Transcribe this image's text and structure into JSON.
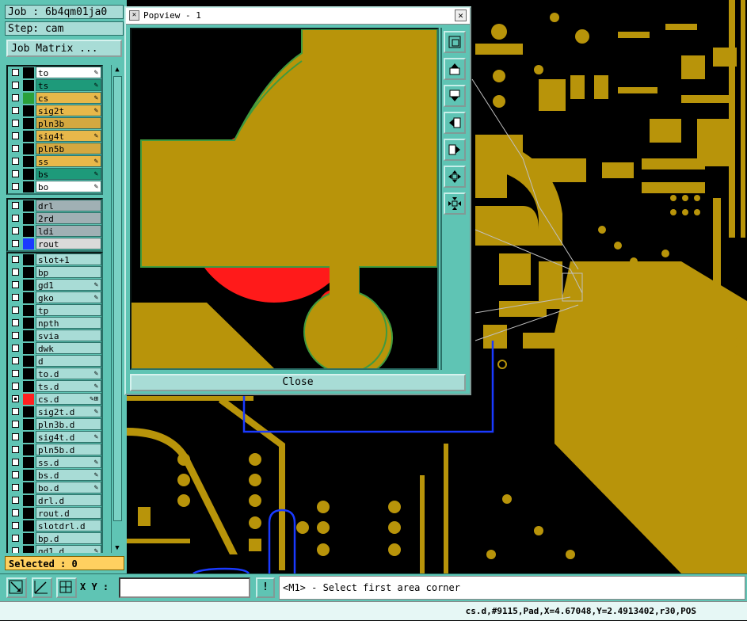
{
  "left_panel": {
    "job": "Job : 6b4qm01ja0",
    "step": "Step: cam",
    "job_matrix": "Job Matrix ...",
    "selected": "Selected : 0",
    "groups": [
      {
        "layers": [
          {
            "name": "to",
            "color": "#000000",
            "bg": "#ffffff",
            "mark": "✎"
          },
          {
            "name": "ts",
            "color": "#000000",
            "bg": "#1e9a7a",
            "mark": "✎"
          },
          {
            "name": "cs",
            "color": "#2aa03a",
            "bg": "#e8b84a",
            "mark": "✎"
          },
          {
            "name": "sig2t",
            "color": "#000000",
            "bg": "#e8b84a",
            "mark": "✎"
          },
          {
            "name": "pln3b",
            "color": "#000000",
            "bg": "#d4a840",
            "mark": ""
          },
          {
            "name": "sig4t",
            "color": "#000000",
            "bg": "#e8b84a",
            "mark": "✎"
          },
          {
            "name": "pln5b",
            "color": "#000000",
            "bg": "#d4a840",
            "mark": ""
          },
          {
            "name": "ss",
            "color": "#000000",
            "bg": "#e8b84a",
            "mark": "✎"
          },
          {
            "name": "bs",
            "color": "#000000",
            "bg": "#1e9a7a",
            "mark": "✎"
          },
          {
            "name": "bo",
            "color": "#000000",
            "bg": "#ffffff",
            "mark": "✎"
          }
        ]
      },
      {
        "layers": [
          {
            "name": "drl",
            "color": "#000000",
            "bg": "#a0b0b4",
            "mark": ""
          },
          {
            "name": "2rd",
            "color": "#000000",
            "bg": "#a0b0b4",
            "mark": ""
          },
          {
            "name": "ldi",
            "color": "#000000",
            "bg": "#a0b0b4",
            "mark": ""
          },
          {
            "name": "rout",
            "color": "#1a3aff",
            "bg": "#dadada",
            "mark": ""
          }
        ]
      },
      {
        "layers": [
          {
            "name": "slot+1",
            "color": "#000000",
            "bg": "#a8dcd6",
            "mark": ""
          },
          {
            "name": "bp",
            "color": "#000000",
            "bg": "#a8dcd6",
            "mark": ""
          },
          {
            "name": "gd1",
            "color": "#000000",
            "bg": "#a8dcd6",
            "mark": "✎"
          },
          {
            "name": "gko",
            "color": "#000000",
            "bg": "#a8dcd6",
            "mark": "✎"
          },
          {
            "name": "tp",
            "color": "#000000",
            "bg": "#a8dcd6",
            "mark": ""
          },
          {
            "name": "npth",
            "color": "#000000",
            "bg": "#a8dcd6",
            "mark": ""
          },
          {
            "name": "svia",
            "color": "#000000",
            "bg": "#a8dcd6",
            "mark": ""
          },
          {
            "name": "dwk",
            "color": "#000000",
            "bg": "#a8dcd6",
            "mark": ""
          },
          {
            "name": "d",
            "color": "#000000",
            "bg": "#a8dcd6",
            "mark": ""
          },
          {
            "name": "to.d",
            "color": "#000000",
            "bg": "#a8dcd6",
            "mark": "✎"
          },
          {
            "name": "ts.d",
            "color": "#000000",
            "bg": "#a8dcd6",
            "mark": "✎"
          },
          {
            "name": "cs.d",
            "color": "#ff2020",
            "bg": "#a8dcd6",
            "mark": "✎⊞",
            "selected": true
          },
          {
            "name": "sig2t.d",
            "color": "#000000",
            "bg": "#a8dcd6",
            "mark": "✎"
          },
          {
            "name": "pln3b.d",
            "color": "#000000",
            "bg": "#a8dcd6",
            "mark": ""
          },
          {
            "name": "sig4t.d",
            "color": "#000000",
            "bg": "#a8dcd6",
            "mark": "✎"
          },
          {
            "name": "pln5b.d",
            "color": "#000000",
            "bg": "#a8dcd6",
            "mark": ""
          },
          {
            "name": "ss.d",
            "color": "#000000",
            "bg": "#a8dcd6",
            "mark": "✎"
          },
          {
            "name": "bs.d",
            "color": "#000000",
            "bg": "#a8dcd6",
            "mark": "✎"
          },
          {
            "name": "bo.d",
            "color": "#000000",
            "bg": "#a8dcd6",
            "mark": "✎"
          },
          {
            "name": "drl.d",
            "color": "#000000",
            "bg": "#a8dcd6",
            "mark": ""
          },
          {
            "name": "rout.d",
            "color": "#000000",
            "bg": "#a8dcd6",
            "mark": ""
          },
          {
            "name": "slotdrl.d",
            "color": "#000000",
            "bg": "#a8dcd6",
            "mark": ""
          },
          {
            "name": "bp.d",
            "color": "#000000",
            "bg": "#a8dcd6",
            "mark": ""
          },
          {
            "name": "gd1.d",
            "color": "#000000",
            "bg": "#a8dcd6",
            "mark": "✎"
          }
        ]
      }
    ]
  },
  "popview": {
    "title": "Popview - 1",
    "close_label": "Close",
    "tools": [
      "zoom-fit-icon",
      "pan-up-icon",
      "pan-down-icon",
      "pan-left-icon",
      "pan-right-icon",
      "zoom-in-icon",
      "zoom-out-icon"
    ]
  },
  "bottom_bar": {
    "xy_label": "X Y :",
    "xy_value": "",
    "excl_label": "!",
    "prompt": "<M1> - Select first area corner"
  },
  "status": "cs.d,#9115,Pad,X=4.67048,Y=2.4913402,r30,POS",
  "colors": {
    "copper": "#b8940a",
    "board": "#000000",
    "highlight": "#ff1a1a",
    "outline": "#1a3aff"
  }
}
